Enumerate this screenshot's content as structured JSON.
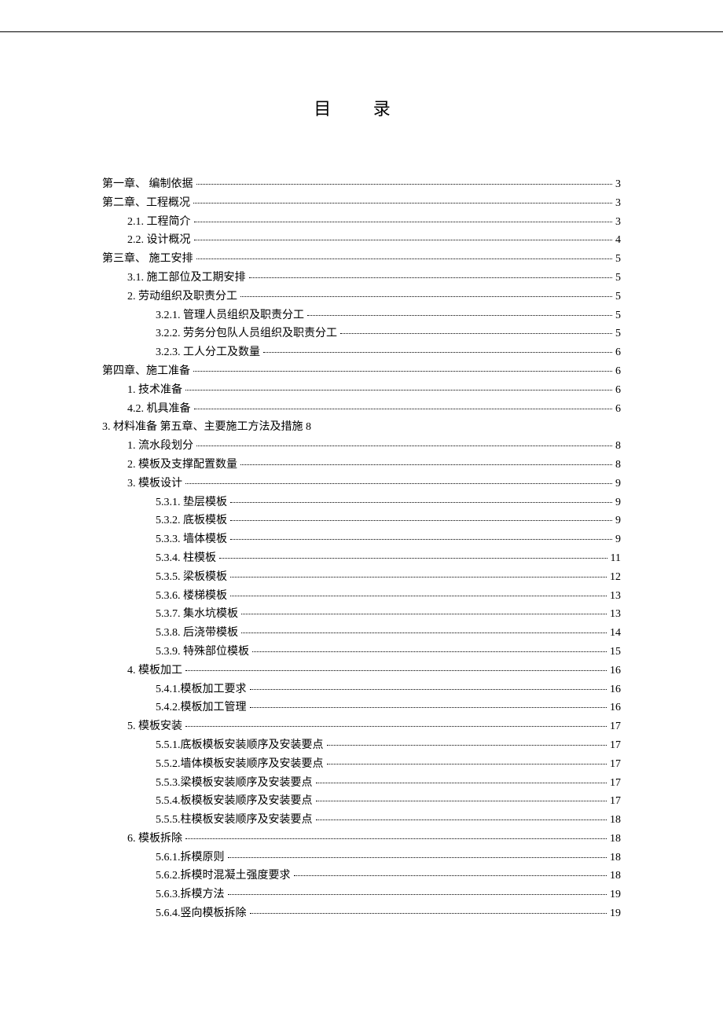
{
  "title": "目 录",
  "items": [
    {
      "indent": 0,
      "label": "第一章、  编制依据",
      "page": "3"
    },
    {
      "indent": 0,
      "label": "第二章、工程概况",
      "page": "3"
    },
    {
      "indent": 1,
      "label": "2.1.  工程简介",
      "page": "3"
    },
    {
      "indent": 1,
      "label": "2.2.  设计概况",
      "page": "4"
    },
    {
      "indent": 0,
      "label": "第三章、  施工安排",
      "page": "5"
    },
    {
      "indent": 1,
      "label": "3.1.  施工部位及工期安排",
      "page": "5"
    },
    {
      "indent": 1,
      "label": "2.  劳动组织及职责分工",
      "page": "5"
    },
    {
      "indent": 2,
      "label": "3.2.1.  管理人员组织及职责分工",
      "page": "5"
    },
    {
      "indent": 2,
      "label": "3.2.2.  劳务分包队人员组织及职责分工",
      "page": "5"
    },
    {
      "indent": 2,
      "label": "3.2.3.  工人分工及数量",
      "page": "6"
    },
    {
      "indent": 0,
      "label": "第四章、施工准备",
      "page": "6"
    },
    {
      "indent": 1,
      "label": "1.  技术准备",
      "page": "6"
    },
    {
      "indent": 1,
      "label": "4.2.  机具准备",
      "page": "6"
    },
    {
      "indent": 0,
      "label": "3.  材料准备  第五章、主要施工方法及措施   8",
      "page": "",
      "noDots": true
    },
    {
      "indent": 1,
      "label": "1.  流水段划分",
      "page": "8"
    },
    {
      "indent": 1,
      "label": "2.  模板及支撑配置数量",
      "page": "8"
    },
    {
      "indent": 1,
      "label": "3.  模板设计",
      "page": "9"
    },
    {
      "indent": 2,
      "label": "5.3.1.  垫层模板",
      "page": "9"
    },
    {
      "indent": 2,
      "label": "5.3.2.  底板模板",
      "page": "9"
    },
    {
      "indent": 2,
      "label": "5.3.3.  墙体模板",
      "page": "9"
    },
    {
      "indent": 2,
      "label": "5.3.4.  柱模板",
      "page": "11"
    },
    {
      "indent": 2,
      "label": "5.3.5.  梁板模板",
      "page": "12"
    },
    {
      "indent": 2,
      "label": "5.3.6.  楼梯模板",
      "page": "13"
    },
    {
      "indent": 2,
      "label": "5.3.7.  集水坑模板",
      "page": "13"
    },
    {
      "indent": 2,
      "label": "5.3.8.  后浇带模板",
      "page": "14"
    },
    {
      "indent": 2,
      "label": "5.3.9.  特殊部位模板",
      "page": "15"
    },
    {
      "indent": 1,
      "label": "4.  模板加工",
      "page": "16"
    },
    {
      "indent": 2,
      "label": "5.4.1.模板加工要求",
      "page": "16"
    },
    {
      "indent": 2,
      "label": "5.4.2.模板加工管理",
      "page": "16"
    },
    {
      "indent": 1,
      "label": "5.  模板安装",
      "page": "17"
    },
    {
      "indent": 2,
      "label": "5.5.1.底板模板安装顺序及安装要点",
      "page": "17"
    },
    {
      "indent": 2,
      "label": "5.5.2.墙体模板安装顺序及安装要点",
      "page": "17"
    },
    {
      "indent": 2,
      "label": "5.5.3.梁模板安装顺序及安装要点",
      "page": "17"
    },
    {
      "indent": 2,
      "label": "5.5.4.板模板安装顺序及安装要点",
      "page": "17"
    },
    {
      "indent": 2,
      "label": "5.5.5.柱模板安装顺序及安装要点",
      "page": "18"
    },
    {
      "indent": 1,
      "label": "6.  模板拆除",
      "page": "18"
    },
    {
      "indent": 2,
      "label": "5.6.1.拆模原则",
      "page": "18"
    },
    {
      "indent": 2,
      "label": "5.6.2.拆模时混凝土强度要求",
      "page": "18"
    },
    {
      "indent": 2,
      "label": "5.6.3.拆模方法",
      "page": "19"
    },
    {
      "indent": 2,
      "label": "5.6.4.竖向模板拆除",
      "page": "19"
    }
  ]
}
